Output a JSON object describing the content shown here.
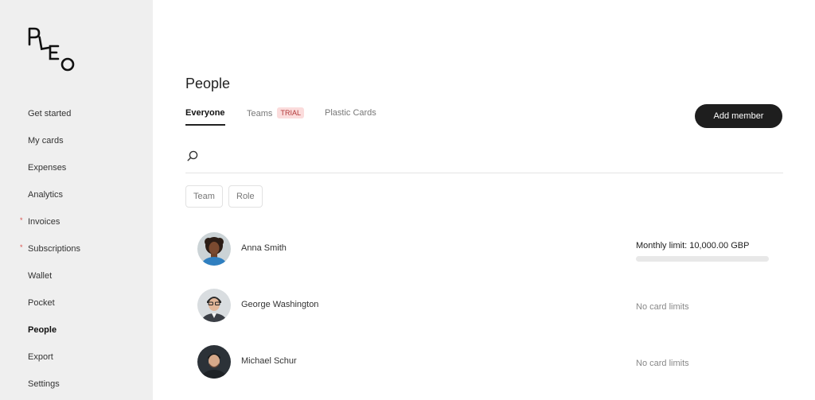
{
  "logo": {
    "text": "PLEO",
    "icon": "pleo-logo"
  },
  "sidebar": {
    "items": [
      {
        "label": "Get started",
        "dot": false,
        "active": false
      },
      {
        "label": "My cards",
        "dot": false,
        "active": false
      },
      {
        "label": "Expenses",
        "dot": false,
        "active": false
      },
      {
        "label": "Analytics",
        "dot": false,
        "active": false
      },
      {
        "label": "Invoices",
        "dot": true,
        "active": false
      },
      {
        "label": "Subscriptions",
        "dot": true,
        "active": false
      },
      {
        "label": "Wallet",
        "dot": false,
        "active": false
      },
      {
        "label": "Pocket",
        "dot": false,
        "active": false
      },
      {
        "label": "People",
        "dot": false,
        "active": true
      },
      {
        "label": "Export",
        "dot": false,
        "active": false
      },
      {
        "label": "Settings",
        "dot": false,
        "active": false
      }
    ],
    "dot_glyph": "*"
  },
  "page": {
    "title": "People"
  },
  "tabs": [
    {
      "label": "Everyone",
      "active": true
    },
    {
      "label": "Teams",
      "badge": "TRIAL",
      "active": false
    },
    {
      "label": "Plastic Cards",
      "active": false
    }
  ],
  "actions": {
    "add_member": "Add member"
  },
  "search": {
    "placeholder": "",
    "value": "",
    "icon": "search-icon"
  },
  "filters": [
    {
      "label": "Team"
    },
    {
      "label": "Role"
    }
  ],
  "people": [
    {
      "name": "Anna Smith",
      "limit": "Monthly limit: 10,000.00 GBP",
      "has_bar": true,
      "bar_fill_fraction": 0.0
    },
    {
      "name": "George Washington",
      "limit": "No card limits",
      "has_bar": false
    },
    {
      "name": "Michael Schur",
      "limit": "No card limits",
      "has_bar": false
    }
  ],
  "colors": {
    "sidebar_bg": "#efefef",
    "primary_button": "#1e1e1e",
    "badge_bg": "#fbdcdc",
    "badge_text": "#b23a3a",
    "dot": "#d9534f"
  }
}
